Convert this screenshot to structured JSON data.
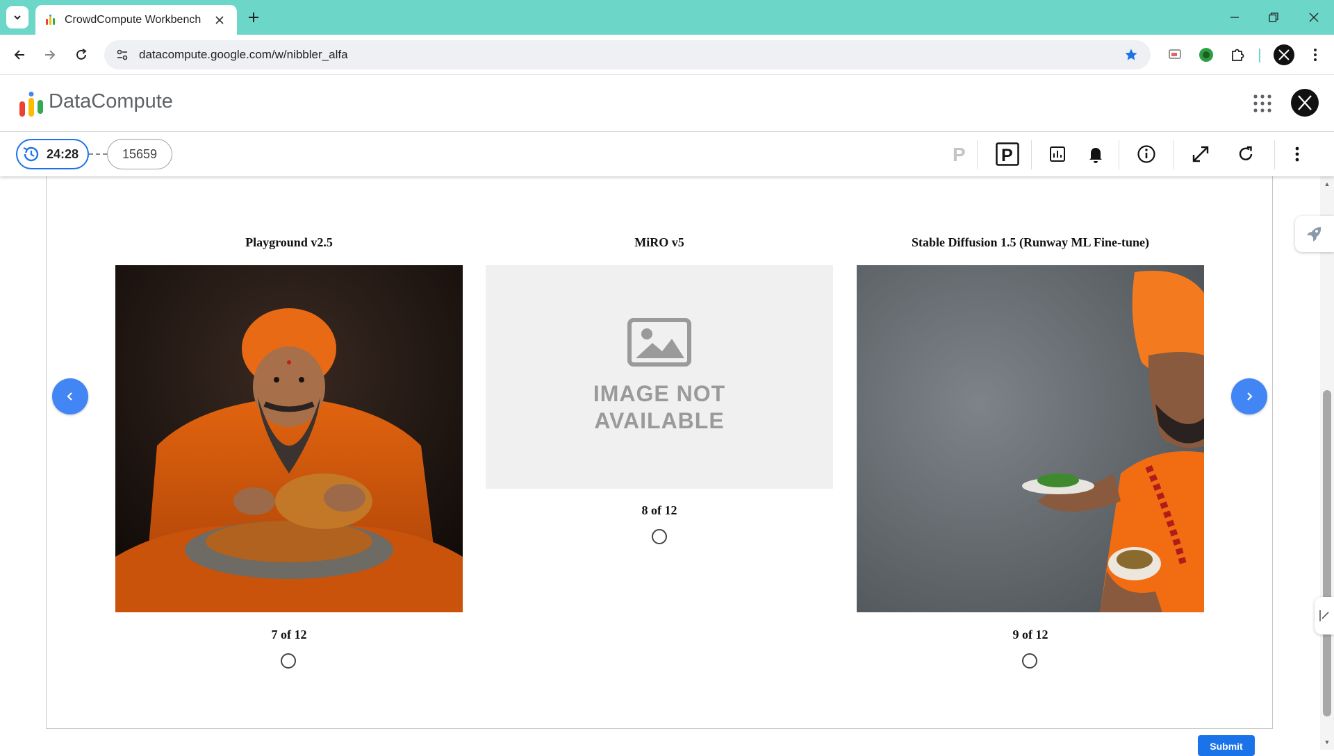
{
  "browser": {
    "tab_title": "CrowdCompute Workbench",
    "url": "datacompute.google.com/w/nibbler_alfa",
    "tabstrip_color": "#6cd6c9"
  },
  "app": {
    "name": "DataCompute",
    "avatar_letter": "X"
  },
  "task_bar": {
    "timer": "24:28",
    "task_id": "15659",
    "icons": [
      "p-faded-icon",
      "p-box-icon",
      "chart-icon",
      "bell-icon",
      "info-icon",
      "expand-icon",
      "refresh-icon",
      "more-vert-icon"
    ]
  },
  "images": [
    {
      "title": "Playground v2.5",
      "count": "7 of 12",
      "selected": false
    },
    {
      "title": "MiRO v5",
      "count": "8 of 12",
      "selected": false,
      "placeholder_line1": "IMAGE NOT",
      "placeholder_line2": "AVAILABLE"
    },
    {
      "title": "Stable Diffusion 1.5 (Runway ML Fine-tune)",
      "count": "9 of 12",
      "selected": false
    }
  ],
  "submit_label": "Submit",
  "colors": {
    "accent": "#1a73e8",
    "carousel": "#4285f4",
    "turban_orange": "#f47a1f"
  }
}
